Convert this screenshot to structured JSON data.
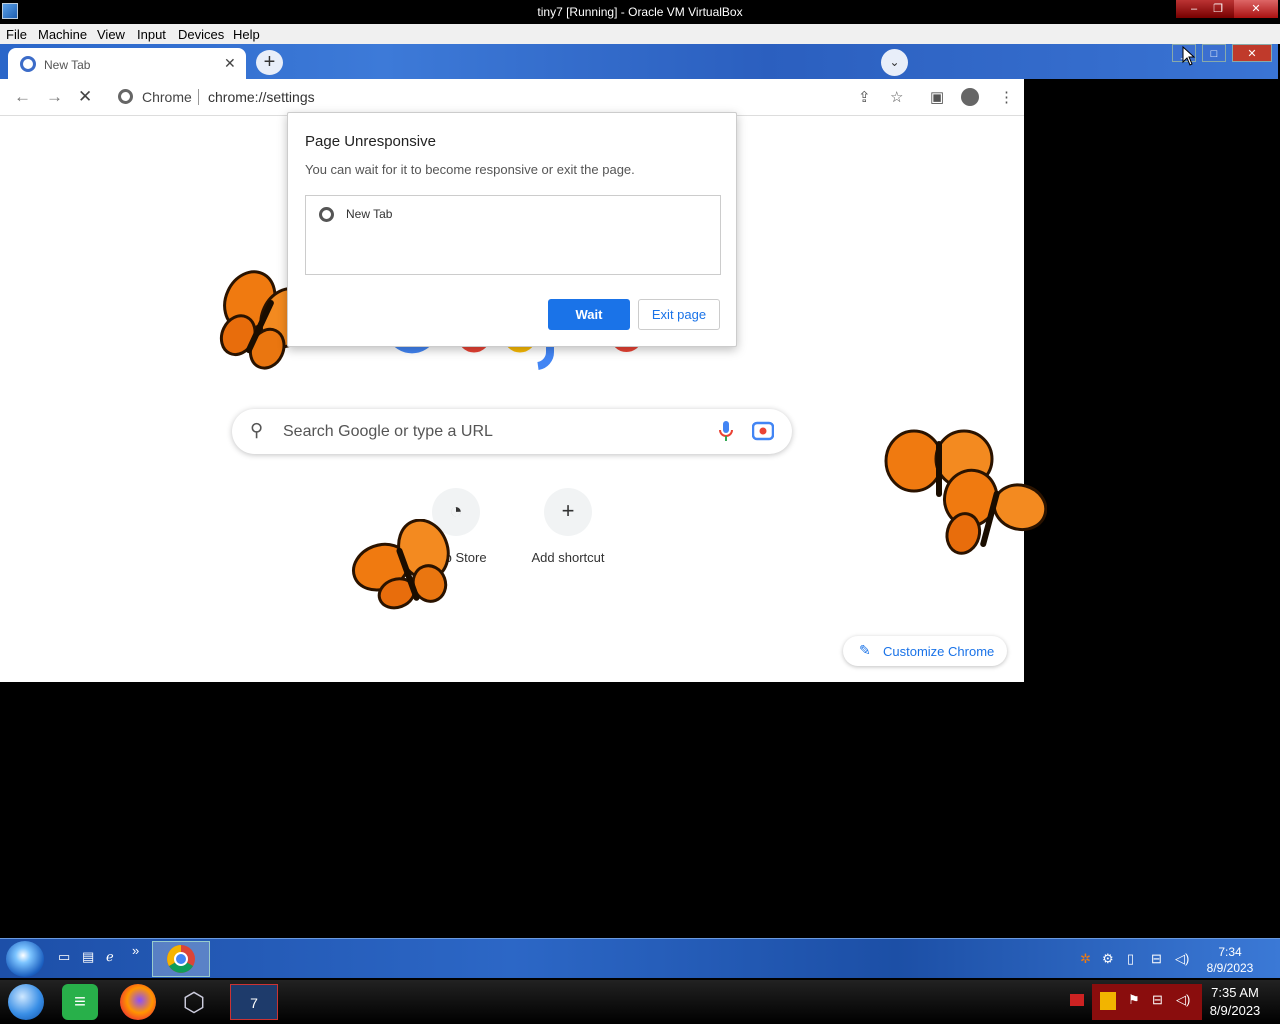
{
  "host": {
    "title": "tiny7 [Running] - Oracle VM VirtualBox",
    "menu": [
      "File",
      "Machine",
      "View",
      "Input",
      "Devices",
      "Help"
    ],
    "clock_time": "7:35 AM",
    "clock_date": "8/9/2023"
  },
  "browser": {
    "tab_title": "New Tab",
    "chip_label": "Chrome",
    "url": "chrome://settings"
  },
  "page": {
    "search_placeholder": "Search Google or type a URL",
    "shortcuts": [
      "Web Store",
      "Add shortcut"
    ],
    "customize_label": "Customize Chrome"
  },
  "dialog": {
    "title": "Page Unresponsive",
    "message": "You can wait for it to become responsive or exit the page.",
    "page_item": "New Tab",
    "wait_label": "Wait",
    "exit_label": "Exit page"
  },
  "guest_taskbar": {
    "clock_time": "7:34",
    "clock_date": "8/9/2023"
  },
  "colors": {
    "accent": "#1a73e8",
    "win7_taskbar": "#2c67c6"
  },
  "icons": [
    "search-icon",
    "mic-icon",
    "lens-icon",
    "pencil-icon",
    "chrome-icon",
    "butterfly-icon"
  ]
}
